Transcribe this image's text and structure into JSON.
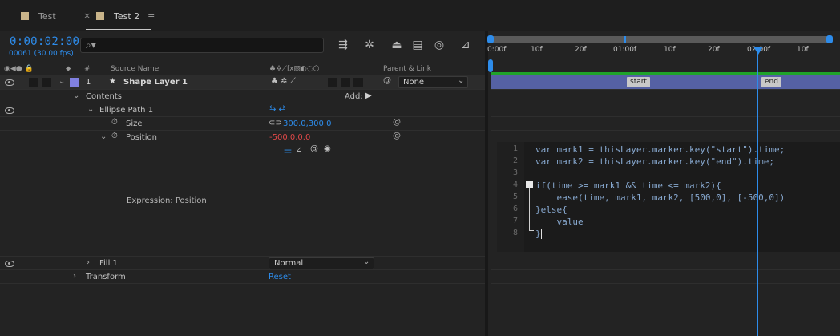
{
  "tabs": [
    {
      "label": "Test",
      "active": false
    },
    {
      "label": "Test 2",
      "active": true
    }
  ],
  "timecode": "0:00:02:00",
  "frames": "00061 (30.00 fps)",
  "search": {
    "placeholder": "",
    "icon": "search-icon"
  },
  "columns": {
    "num": "#",
    "source": "Source Name",
    "parent": "Parent & Link"
  },
  "layer": {
    "num": "1",
    "name": "Shape Layer 1",
    "parent": "None"
  },
  "contents": {
    "label": "Contents",
    "add": "Add:"
  },
  "ellipse": {
    "label": "Ellipse Path 1"
  },
  "size": {
    "label": "Size",
    "value": "300.0,300.0"
  },
  "position": {
    "label": "Position",
    "value": "-500.0,0.0"
  },
  "expression_label": "Expression: Position",
  "fill": {
    "label": "Fill 1",
    "mode": "Normal"
  },
  "transform": {
    "label": "Transform",
    "reset": "Reset"
  },
  "ruler": [
    "0:00f",
    "10f",
    "20f",
    "01:00f",
    "10f",
    "20f",
    "02:00f",
    "10f"
  ],
  "markers": {
    "start": "start",
    "end": "end"
  },
  "code": [
    "var mark1 = thisLayer.marker.key(\"start\").time;",
    "var mark2 = thisLayer.marker.key(\"end\").time;",
    "",
    "if(time >= mark1 && time <= mark2){",
    "    ease(time, mark1, mark2, [500,0], [-500,0])",
    "}else{",
    "    value",
    "}"
  ],
  "line_numbers": [
    "1",
    "2",
    "3",
    "4",
    "5",
    "6",
    "7",
    "8"
  ],
  "colors": {
    "accent": "#2d8ceb",
    "layer_bar": "#5561a4",
    "label_swatch": "#8080e0",
    "green_bar": "#1fa32a"
  }
}
